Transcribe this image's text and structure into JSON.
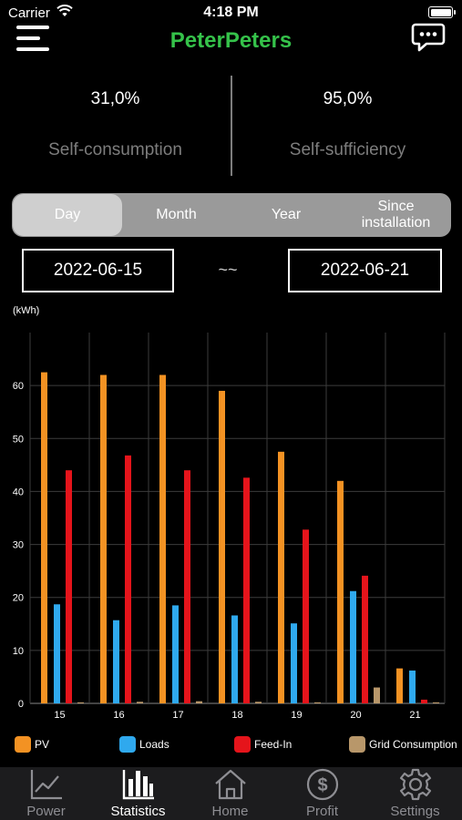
{
  "status_bar": {
    "carrier": "Carrier",
    "time": "4:18 PM"
  },
  "header": {
    "title": "PeterPeters",
    "menu_icon": "hamburger-icon",
    "chat_icon": "chat-bubble-icon",
    "title_color": "#35c24a"
  },
  "summary": {
    "self_consumption_value": "31,0%",
    "self_consumption_label": "Self-consumption",
    "self_sufficiency_value": "95,0%",
    "self_sufficiency_label": "Self-sufficiency"
  },
  "period_tabs": [
    {
      "label": "Day",
      "active": true
    },
    {
      "label": "Month",
      "active": false
    },
    {
      "label": "Year",
      "active": false
    },
    {
      "label": "Since installation",
      "active": false
    }
  ],
  "date_range": {
    "start": "2022-06-15",
    "separator": "~~",
    "end": "2022-06-21"
  },
  "chart_data": {
    "type": "bar",
    "ylabel": "(kWh)",
    "ylim": [
      0,
      70
    ],
    "yticks": [
      0,
      10,
      20,
      30,
      40,
      50,
      60
    ],
    "categories": [
      "15",
      "16",
      "17",
      "18",
      "19",
      "20",
      "21"
    ],
    "grid": true,
    "series": [
      {
        "name": "PV",
        "color": "#f39223",
        "values": [
          62.5,
          62,
          62,
          59,
          47.5,
          42,
          6.6
        ]
      },
      {
        "name": "Loads",
        "color": "#2fa9ee",
        "values": [
          18.7,
          15.7,
          18.5,
          16.6,
          15.1,
          21.2,
          6.2
        ]
      },
      {
        "name": "Feed-In",
        "color": "#e5141b",
        "values": [
          44,
          46.8,
          44,
          42.6,
          32.8,
          24.1,
          0.7
        ]
      },
      {
        "name": "Grid Consumption",
        "color": "#b8976a",
        "values": [
          0.2,
          0.3,
          0.4,
          0.3,
          0.2,
          3,
          0.2
        ]
      }
    ]
  },
  "tabbar": [
    {
      "label": "Power",
      "icon": "line-chart-icon",
      "active": false
    },
    {
      "label": "Statistics",
      "icon": "bar-chart-icon",
      "active": true
    },
    {
      "label": "Home",
      "icon": "house-icon",
      "active": false
    },
    {
      "label": "Profit",
      "icon": "dollar-circle-icon",
      "active": false
    },
    {
      "label": "Settings",
      "icon": "gear-icon",
      "active": false
    }
  ]
}
